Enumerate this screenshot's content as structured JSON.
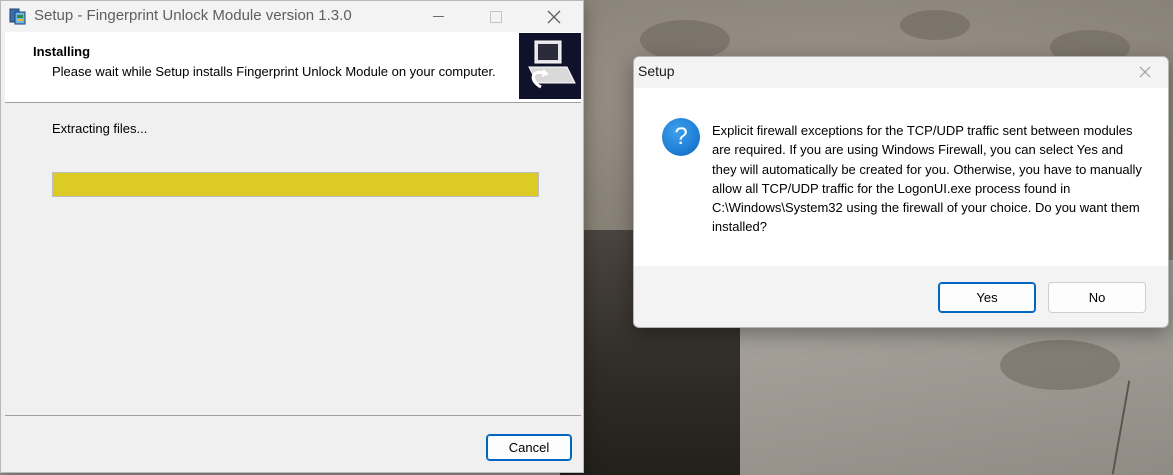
{
  "installer": {
    "title": "Setup - Fingerprint Unlock Module version 1.3.0",
    "header_title": "Installing",
    "header_subtitle": "Please wait while Setup installs Fingerprint Unlock Module on your computer.",
    "status_text": "Extracting files...",
    "progress_fraction": 1.0,
    "progress_color": "#dccb25",
    "cancel_label": "Cancel",
    "icons": [
      "setup-app-icon",
      "minimize-icon",
      "maximize-icon",
      "close-icon",
      "installer-logo"
    ]
  },
  "dialog": {
    "title": "Setup",
    "message": "Explicit firewall exceptions for the TCP/UDP traffic sent between modules are required. If you are using Windows Firewall, you can select Yes and they will automatically be created for you. Otherwise, you have to manually allow all TCP/UDP traffic for the LogonUI.exe process found in C:\\Windows\\System32 using the firewall of your choice. Do you want them installed?",
    "icon_glyph": "?",
    "yes_label": "Yes",
    "no_label": "No",
    "accent_color": "#0067c0"
  }
}
